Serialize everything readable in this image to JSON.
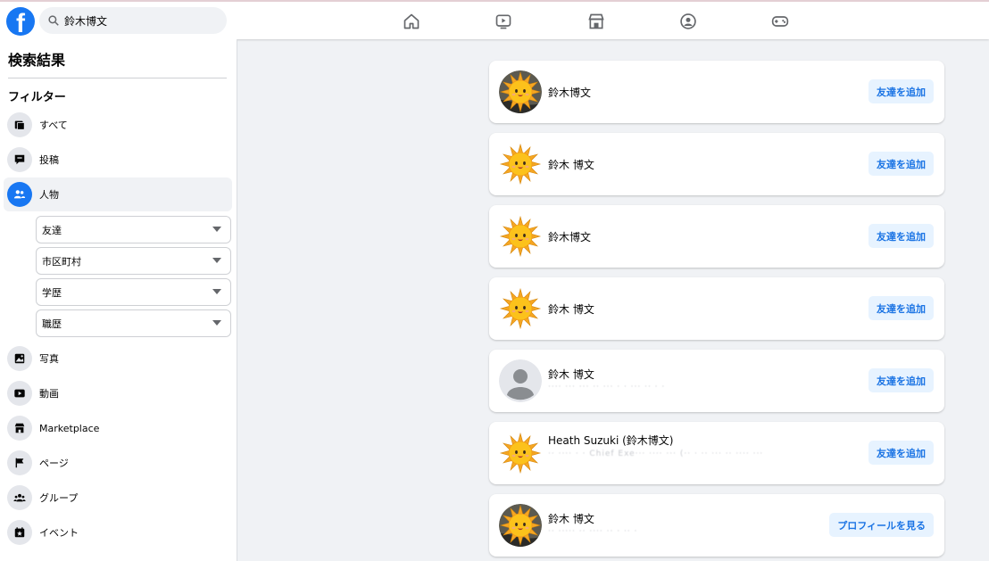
{
  "header": {
    "logo": "f",
    "search_value": "鈴木博文",
    "nav_icons": [
      "home-icon",
      "watch-icon",
      "marketplace-icon",
      "groups-icon",
      "gaming-icon"
    ]
  },
  "sidebar": {
    "title": "検索結果",
    "filter_heading": "フィルター",
    "items": [
      {
        "label": "すべて",
        "icon": "all-icon"
      },
      {
        "label": "投稿",
        "icon": "posts-icon"
      },
      {
        "label": "人物",
        "icon": "people-icon",
        "active": true
      },
      {
        "label": "写真",
        "icon": "photos-icon"
      },
      {
        "label": "動画",
        "icon": "videos-icon"
      },
      {
        "label": "Marketplace",
        "icon": "marketplace-icon"
      },
      {
        "label": "ページ",
        "icon": "pages-icon"
      },
      {
        "label": "グループ",
        "icon": "groups-icon"
      },
      {
        "label": "イベント",
        "icon": "events-icon"
      }
    ],
    "people_filters": [
      "友達",
      "市区町村",
      "学歴",
      "職歴"
    ]
  },
  "results": [
    {
      "name": "鈴木博文",
      "sub": "",
      "button": "友達を追加",
      "avatar": "sun-avatar-photo"
    },
    {
      "name": "鈴木 博文",
      "sub": "",
      "button": "友達を追加",
      "avatar": "sun-avatar"
    },
    {
      "name": "鈴木博文",
      "sub": "",
      "button": "友達を追加",
      "avatar": "sun-avatar"
    },
    {
      "name": "鈴木 博文",
      "sub": "",
      "button": "友達を追加",
      "avatar": "sun-avatar"
    },
    {
      "name": "鈴木 博文",
      "sub": "····  ··· ··· ·· ··· ·  ·   ··· ·· · ·",
      "button": "友達を追加",
      "avatar": "default-avatar"
    },
    {
      "name": "Heath Suzuki (鈴木博文)",
      "sub": "·· ···· · · Chief Exe··· ···· ··· (·· · ·· ··· ·· ···· ···",
      "button": "友達を追加",
      "avatar": "sun-avatar"
    },
    {
      "name": "鈴木 博文",
      "sub": "·· ····· ·· ···· ·· · ·· ·",
      "button": "プロフィールを見る",
      "avatar": "sun-avatar"
    }
  ],
  "colors": {
    "brand": "#1877f2",
    "button_bg": "#e7f3ff",
    "button_text": "#1b74e4",
    "page_bg": "#f0f2f5"
  }
}
